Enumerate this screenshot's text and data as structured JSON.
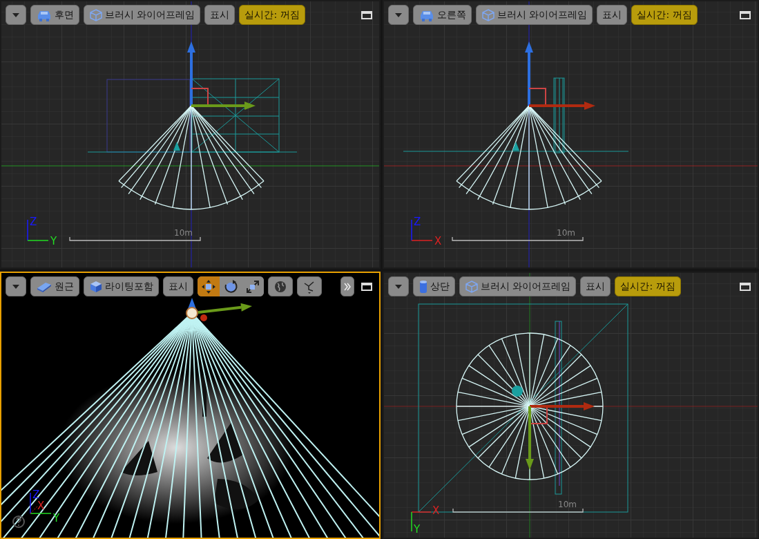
{
  "viewports": [
    {
      "kind": "side",
      "active": false,
      "view_button": {
        "kind": "car",
        "label": "후면"
      },
      "mode_button": {
        "kind": "wire-cube",
        "label": "브러시 와이어프레임"
      },
      "show_label": "표시",
      "realtime_label": "실시간: 꺼짐",
      "axis_labels": [
        {
          "text": "Z",
          "color": "#1a1aff"
        },
        {
          "text": "Y",
          "color": "#22dd22"
        }
      ],
      "scale_label": "10m"
    },
    {
      "kind": "side",
      "active": false,
      "view_button": {
        "kind": "car",
        "label": "오른쪽"
      },
      "mode_button": {
        "kind": "wire-cube",
        "label": "브러시 와이어프레임"
      },
      "show_label": "표시",
      "realtime_label": "실시간: 꺼짐",
      "axis_labels": [
        {
          "text": "Z",
          "color": "#1a1aff"
        },
        {
          "text": "X",
          "color": "#dd2222"
        }
      ],
      "scale_label": "10m"
    },
    {
      "kind": "perspective",
      "active": true,
      "view_button": {
        "kind": "slab",
        "label": "원근"
      },
      "mode_button": {
        "kind": "solid-cube",
        "label": "라이팅포함"
      },
      "show_label": "표시",
      "tools": [
        {
          "kind": "move",
          "selected": true
        },
        {
          "kind": "rotate",
          "selected": false
        },
        {
          "kind": "scale",
          "selected": false
        }
      ],
      "axis_labels": [
        {
          "text": "Z",
          "color": "#1a1aff"
        },
        {
          "text": "X",
          "color": "#dd2222"
        },
        {
          "text": "Y",
          "color": "#22dd22"
        }
      ]
    },
    {
      "kind": "top",
      "active": false,
      "view_button": {
        "kind": "cylinder",
        "label": "상단"
      },
      "mode_button": {
        "kind": "wire-cube",
        "label": "브러시 와이어프레임"
      },
      "show_label": "표시",
      "realtime_label": "실시간: 꺼짐",
      "axis_labels": [
        {
          "text": "X",
          "color": "#dd2222"
        },
        {
          "text": "Y",
          "color": "#22dd22"
        }
      ],
      "scale_label": "10m"
    }
  ]
}
